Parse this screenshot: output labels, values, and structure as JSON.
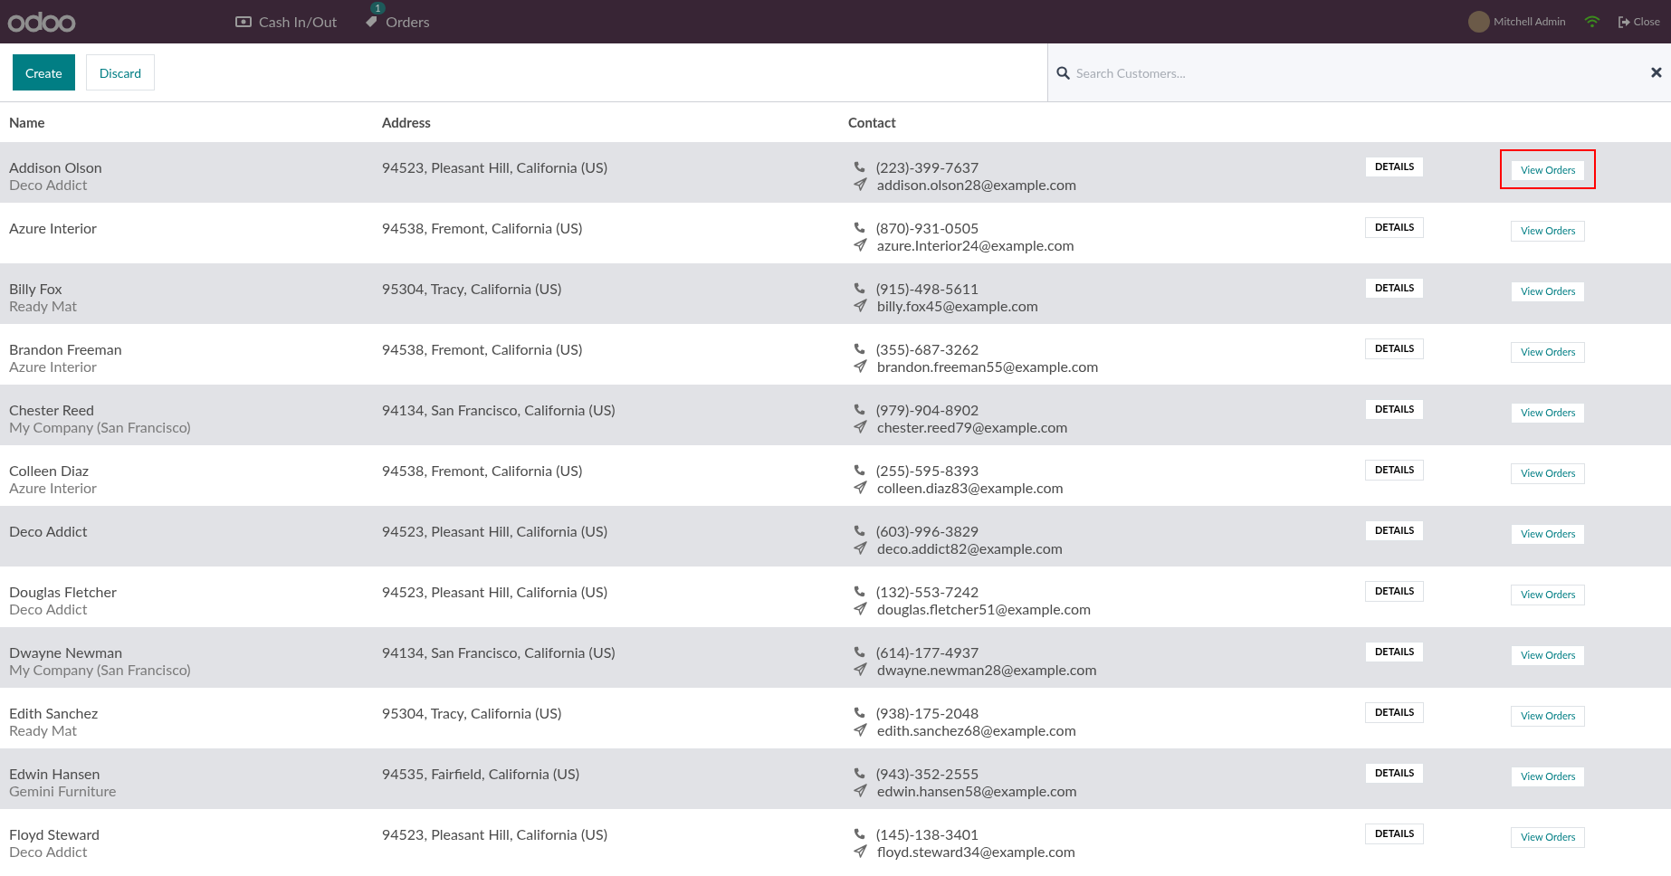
{
  "navbar": {
    "menu": [
      {
        "kind": "cash",
        "label": "Cash In/Out"
      },
      {
        "kind": "orders",
        "label": "Orders",
        "badge": "1"
      }
    ],
    "user": "Mitchell Admin",
    "close": "Close"
  },
  "toolbar": {
    "create": "Create",
    "discard": "Discard",
    "search": {
      "placeholder": "Search Customers..."
    }
  },
  "table": {
    "columns": [
      "Name",
      "Address",
      "Contact"
    ],
    "rows": [
      {
        "name": "Addison Olson",
        "company": "Deco Addict",
        "address": "94523, Pleasant Hill, California (US)",
        "phone": "(223)-399-7637",
        "email": "addison.olson28@example.com",
        "details": "DETAILS",
        "view": "View Orders",
        "selected": true,
        "highlighted": true
      },
      {
        "name": "Azure Interior",
        "address": "94538, Fremont, California (US)",
        "phone": "(870)-931-0505",
        "email": "azure.Interior24@example.com",
        "details": "DETAILS",
        "view": "View Orders",
        "selected": false,
        "highlighted": false
      },
      {
        "name": "Billy Fox",
        "company": "Ready Mat",
        "address": "95304, Tracy, California (US)",
        "phone": "(915)-498-5611",
        "email": "billy.fox45@example.com",
        "details": "DETAILS",
        "view": "View Orders",
        "selected": true,
        "highlighted": false
      },
      {
        "name": "Brandon Freeman",
        "company": "Azure Interior",
        "address": "94538, Fremont, California (US)",
        "phone": "(355)-687-3262",
        "email": "brandon.freeman55@example.com",
        "details": "DETAILS",
        "view": "View Orders",
        "selected": false,
        "highlighted": false
      },
      {
        "name": "Chester Reed",
        "company": "My Company (San Francisco)",
        "address": "94134, San Francisco, California (US)",
        "phone": "(979)-904-8902",
        "email": "chester.reed79@example.com",
        "details": "DETAILS",
        "view": "View Orders",
        "selected": true,
        "highlighted": false
      },
      {
        "name": "Colleen Diaz",
        "company": "Azure Interior",
        "address": "94538, Fremont, California (US)",
        "phone": "(255)-595-8393",
        "email": "colleen.diaz83@example.com",
        "details": "DETAILS",
        "view": "View Orders",
        "selected": false,
        "highlighted": false
      },
      {
        "name": "Deco Addict",
        "address": "94523, Pleasant Hill, California (US)",
        "phone": "(603)-996-3829",
        "email": "deco.addict82@example.com",
        "details": "DETAILS",
        "view": "View Orders",
        "selected": true,
        "highlighted": false
      },
      {
        "name": "Douglas Fletcher",
        "company": "Deco Addict",
        "address": "94523, Pleasant Hill, California (US)",
        "phone": "(132)-553-7242",
        "email": "douglas.fletcher51@example.com",
        "details": "DETAILS",
        "view": "View Orders",
        "selected": false,
        "highlighted": false
      },
      {
        "name": "Dwayne Newman",
        "company": "My Company (San Francisco)",
        "address": "94134, San Francisco, California (US)",
        "phone": "(614)-177-4937",
        "email": "dwayne.newman28@example.com",
        "details": "DETAILS",
        "view": "View Orders",
        "selected": true,
        "highlighted": false
      },
      {
        "name": "Edith Sanchez",
        "company": "Ready Mat",
        "address": "95304, Tracy, California (US)",
        "phone": "(938)-175-2048",
        "email": "edith.sanchez68@example.com",
        "details": "DETAILS",
        "view": "View Orders",
        "selected": false,
        "highlighted": false
      },
      {
        "name": "Edwin Hansen",
        "company": "Gemini Furniture",
        "address": "94535, Fairfield, California (US)",
        "phone": "(943)-352-2555",
        "email": "edwin.hansen58@example.com",
        "details": "DETAILS",
        "view": "View Orders",
        "selected": true,
        "highlighted": false
      },
      {
        "name": "Floyd Steward",
        "company": "Deco Addict",
        "address": "94523, Pleasant Hill, California (US)",
        "phone": "(145)-138-3401",
        "email": "floyd.steward34@example.com",
        "details": "DETAILS",
        "view": "View Orders",
        "selected": false,
        "highlighted": false
      }
    ]
  }
}
